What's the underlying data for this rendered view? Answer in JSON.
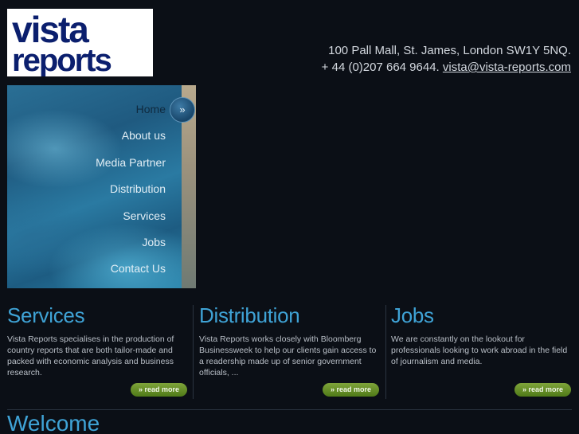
{
  "logo": {
    "line1": "vista",
    "line2": "reports",
    "brand_color": "#0b1f6e"
  },
  "contact": {
    "address": "100 Pall Mall, St. James, London SW1Y 5NQ.",
    "phone": "+ 44 (0)207 664 9644.",
    "email": "vista@vista-reports.com"
  },
  "nav": {
    "active_icon": "chevron-right-icon",
    "items": [
      {
        "label": "Home"
      },
      {
        "label": "About us"
      },
      {
        "label": "Media Partner"
      },
      {
        "label": "Distribution"
      },
      {
        "label": "Services"
      },
      {
        "label": "Jobs"
      },
      {
        "label": "Contact Us"
      }
    ]
  },
  "columns": [
    {
      "title": "Services",
      "text": "Vista Reports specialises in the production of country reports that are both tailor-made and packed with economic analysis and business research.",
      "button": "» read more"
    },
    {
      "title": "Distribution",
      "text": "Vista Reports works closely with Bloomberg Businessweek to help our clients gain access to a readership made up of senior government officials, ...",
      "button": "» read more"
    },
    {
      "title": "Jobs",
      "text": "We are constantly on the lookout for professionals looking to work abroad in the field of journalism and media.",
      "button": "» read more"
    }
  ],
  "welcome": {
    "title": "Welcome"
  },
  "colors": {
    "accent": "#3fa3d6",
    "button_green": "#5f8a22",
    "background": "#0b0f16"
  }
}
